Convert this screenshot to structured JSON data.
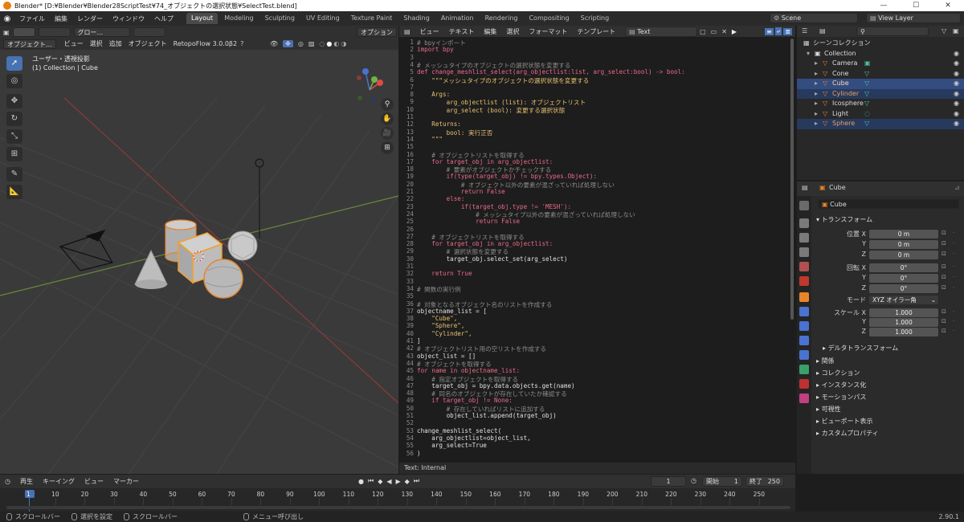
{
  "window": {
    "title": "Blender* [D:¥Blender¥Blender28ScriptTest¥74_オブジェクトの選択状態¥SelectTest.blend]"
  },
  "menu": [
    "ファイル",
    "編集",
    "レンダー",
    "ウィンドウ",
    "ヘルプ"
  ],
  "workspaces": [
    "Layout",
    "Modeling",
    "Sculpting",
    "UV Editing",
    "Texture Paint",
    "Shading",
    "Animation",
    "Rendering",
    "Compositing",
    "Scripting"
  ],
  "scene": {
    "name": "Scene",
    "view_layer": "View Layer"
  },
  "viewport": {
    "mode": "オブジェクト...",
    "menus": [
      "ビュー",
      "選択",
      "追加",
      "オブジェクト"
    ],
    "addon": "RetopoFlow 3.0.0β2",
    "transform": "グロー...",
    "options": "オプション",
    "view_name": "ユーザー・透視投影",
    "collection_info": "(1) Collection | Cube"
  },
  "text_editor": {
    "menus": [
      "ビュー",
      "テキスト",
      "編集",
      "選択",
      "フォーマット",
      "テンプレート"
    ],
    "text_name": "Text",
    "status": "Text: Internal",
    "lines": [
      "# bpyインポート",
      "import bpy",
      "",
      "# メッシュタイプのオブジェクトの選択状態を変更する",
      "def change_meshlist_select(arg_objectlist:list, arg_select:bool) -> bool:",
      "    \"\"\"メッシュタイプのオブジェクトの選択状態を変更する",
      "",
      "    Args:",
      "        arg_objectlist (list): オブジェクトリスト",
      "        arg_select (bool): 変更する選択状態",
      "",
      "    Returns:",
      "        bool: 実行正否",
      "    \"\"\"",
      "",
      "    # オブジェクトリストを取得する",
      "    for target_obj in arg_objectlist:",
      "        # 要素がオブジェクトかチェックする",
      "        if(type(target_obj) != bpy.types.Object):",
      "            # オブジェクト以外の要素が混ざっていれば処理しない",
      "            return False",
      "        else:",
      "            if(target_obj.type != 'MESH'):",
      "                # メッシュタイプ以外の要素が混ざっていれば処理しない",
      "                return False",
      "",
      "    # オブジェクトリストを取得する",
      "    for target_obj in arg_objectlist:",
      "        # 選択状態を変更する",
      "        target_obj.select_set(arg_select)",
      "",
      "    return True",
      "",
      "# 関数の実行例",
      "",
      "# 対象となるオブジェクト名のリストを作成する",
      "objectname_list = [",
      "    \"Cube\",",
      "    \"Sphere\",",
      "    \"Cylinder\",",
      "]",
      "# オブジェクトリスト用の空リストを作成する",
      "object_list = []",
      "# オブジェクトを取得する",
      "for name in objectname_list:",
      "    # 指定オブジェクトを取得する",
      "    target_obj = bpy.data.objects.get(name)",
      "    # 同名のオブジェクトが存在していたか確認する",
      "    if target_obj != None:",
      "        # 存在していればリストに追加する",
      "        object_list.append(target_obj)",
      "",
      "change_meshlist_select(",
      "    arg_objectlist=object_list,",
      "    arg_select=True",
      ")"
    ]
  },
  "outliner": {
    "root": "シーンコレクション",
    "items": [
      {
        "name": "Collection",
        "level": 1,
        "state": "none"
      },
      {
        "name": "Camera",
        "level": 2,
        "state": "none"
      },
      {
        "name": "Cone",
        "level": 2,
        "state": "none"
      },
      {
        "name": "Cube",
        "level": 2,
        "state": "active"
      },
      {
        "name": "Cylinder",
        "level": 2,
        "state": "selected"
      },
      {
        "name": "Icosphere",
        "level": 2,
        "state": "none"
      },
      {
        "name": "Light",
        "level": 2,
        "state": "none"
      },
      {
        "name": "Sphere",
        "level": 2,
        "state": "selected"
      }
    ]
  },
  "properties": {
    "object_name": "Cube",
    "object_field": "Cube",
    "transform_title": "トランスフォーム",
    "location_label": "位置 X",
    "rotation_label": "回転 X",
    "scale_label": "スケール X",
    "y_label": "Y",
    "z_label": "Z",
    "loc": [
      "0 m",
      "0 m",
      "0 m"
    ],
    "rot": [
      "0°",
      "0°",
      "0°"
    ],
    "mode_label": "モード",
    "mode_value": "XYZ オイラー角",
    "scale": [
      "1.000",
      "1.000",
      "1.000"
    ],
    "delta": "デルタトランスフォーム",
    "sections": [
      "関係",
      "コレクション",
      "インスタンス化",
      "モーションパス",
      "可視性",
      "ビューポート表示",
      "カスタムプロパティ"
    ]
  },
  "timeline": {
    "menus": [
      "再生",
      "キーイング",
      "ビュー",
      "マーカー"
    ],
    "current_frame": "1",
    "start_label": "開始",
    "start": "1",
    "end_label": "終了",
    "end": "250",
    "ticks": [
      "1",
      "10",
      "20",
      "30",
      "40",
      "50",
      "60",
      "70",
      "80",
      "90",
      "100",
      "110",
      "120",
      "130",
      "140",
      "150",
      "160",
      "170",
      "180",
      "190",
      "200",
      "210",
      "220",
      "230",
      "240",
      "250"
    ]
  },
  "statusbar": {
    "items": [
      "スクロールバー",
      "選択を設定",
      "スクロールバー",
      "メニュー呼び出し"
    ],
    "version": "2.90.1"
  }
}
